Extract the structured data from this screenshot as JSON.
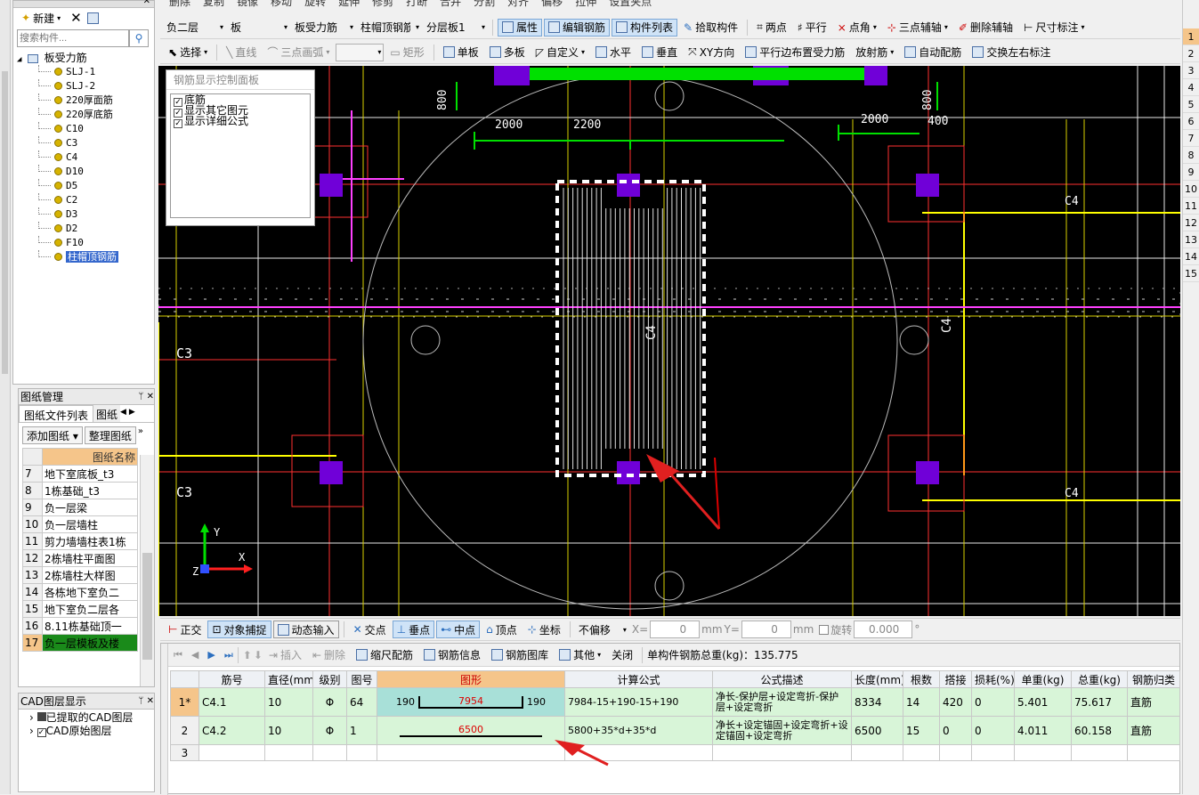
{
  "top_toolbar": [
    "删除",
    "复制",
    "镜像",
    "移动",
    "旋转",
    "延伸",
    "修剪",
    "打断",
    "合并",
    "分割",
    "对齐",
    "偏移",
    "拉伸",
    "设置夹点"
  ],
  "component_panel": {
    "new_label": "新建",
    "search_placeholder": "搜索构件...",
    "root": "板受力筋",
    "items": [
      "SLJ-1",
      "SLJ-2",
      "220厚面筋",
      "220厚底筋",
      "C10",
      "C3",
      "C4",
      "D10",
      "D5",
      "C2",
      "D3",
      "D2",
      "F10",
      "柱帽顶钢筋"
    ],
    "selected": "柱帽顶钢筋"
  },
  "drawing_panel": {
    "title": "图纸管理",
    "tabs": [
      "图纸文件列表",
      "图纸"
    ],
    "add_label": "添加图纸",
    "organize_label": "整理图纸",
    "header": "图纸名称",
    "rows": [
      {
        "no": "7",
        "name": "地下室底板_t3"
      },
      {
        "no": "8",
        "name": "1栋基础_t3"
      },
      {
        "no": "9",
        "name": "负一层梁"
      },
      {
        "no": "10",
        "name": "负一层墙柱"
      },
      {
        "no": "11",
        "name": "剪力墙墙柱表1栋"
      },
      {
        "no": "12",
        "name": "2栋墙柱平面图"
      },
      {
        "no": "13",
        "name": "2栋墙柱大样图"
      },
      {
        "no": "14",
        "name": "各栋地下室负二"
      },
      {
        "no": "15",
        "name": "地下室负二层各"
      },
      {
        "no": "16",
        "name": "8.11栋基础顶一"
      },
      {
        "no": "17",
        "name": "负一层模板及楼"
      }
    ]
  },
  "cad_panel": {
    "title": "CAD图层显示",
    "items": [
      "已提取的CAD图层",
      "CAD原始图层"
    ]
  },
  "toolbar1": {
    "floor": "负二层",
    "type": "板",
    "subtype": "板受力筋",
    "component": "柱帽顶钢筋",
    "layer": "分层板1",
    "buttons": [
      "属性",
      "编辑钢筋",
      "构件列表",
      "拾取构件",
      "两点",
      "平行",
      "点角",
      "三点辅轴",
      "删除辅轴",
      "尺寸标注"
    ]
  },
  "toolbar2": {
    "buttons": [
      "选择",
      "直线",
      "三点画弧",
      "矩形",
      "单板",
      "多板",
      "自定义",
      "水平",
      "垂直",
      "XY方向",
      "平行边布置受力筋",
      "放射筋",
      "自动配筋",
      "交换左右标注"
    ]
  },
  "rebar_panel": {
    "title": "钢筋显示控制面板",
    "options": [
      "底筋",
      "显示其它图元",
      "显示详细公式"
    ]
  },
  "cad_labels": {
    "c3": "C3",
    "c4": "C4",
    "d800": "800",
    "d2000": "2000",
    "d2200": "2200",
    "d400": "400",
    "axis_y": "Y",
    "axis_x": "X",
    "axis_z": "Z"
  },
  "status_bar": {
    "buttons": [
      "正交",
      "对象捕捉",
      "动态输入",
      "交点",
      "垂点",
      "中点",
      "顶点",
      "坐标"
    ],
    "offset_mode": "不偏移",
    "x_label": "X=",
    "x_val": "0",
    "mm1": "mm",
    "y_label": "Y=",
    "y_val": "0",
    "mm2": "mm",
    "rotate_label": "旋转",
    "rotate_val": "0.000",
    "deg": "°"
  },
  "rebar_toolbar": {
    "buttons": [
      "插入",
      "删除",
      "缩尺配筋",
      "钢筋信息",
      "钢筋图库",
      "其他",
      "关闭"
    ],
    "total": "单构件钢筋总重(kg)：135.775"
  },
  "grid": {
    "headers": [
      "筋号",
      "直径(mm)",
      "级别",
      "图号",
      "图形",
      "计算公式",
      "公式描述",
      "长度(mm)",
      "根数",
      "搭接",
      "损耗(%)",
      "单重(kg)",
      "总重(kg)",
      "钢筋归类"
    ],
    "rows": [
      {
        "idx": "1*",
        "name": "C4.1",
        "dia": "10",
        "grade": "Φ",
        "fig": "64",
        "shape_l": "190",
        "shape_mid": "7954",
        "shape_r": "190",
        "formula": "7984-15+190-15+190",
        "desc": "净长-保护层+设定弯折-保护层+设定弯折",
        "len": "8334",
        "count": "14",
        "lap": "420",
        "loss": "0",
        "unit": "5.401",
        "total": "75.617",
        "cat": "直筋"
      },
      {
        "idx": "2",
        "name": "C4.2",
        "dia": "10",
        "grade": "Φ",
        "fig": "1",
        "shape_l": "",
        "shape_mid": "6500",
        "shape_r": "",
        "formula": "5800+35*d+35*d",
        "desc": "净长+设定锚固+设定弯折+设定锚固+设定弯折",
        "len": "6500",
        "count": "15",
        "lap": "0",
        "loss": "0",
        "unit": "4.011",
        "total": "60.158",
        "cat": "直筋"
      },
      {
        "idx": "3",
        "name": "",
        "dia": "",
        "grade": "",
        "fig": "",
        "shape_l": "",
        "shape_mid": "",
        "shape_r": "",
        "formula": "",
        "desc": "",
        "len": "",
        "count": "",
        "lap": "",
        "loss": "",
        "unit": "",
        "total": "",
        "cat": ""
      }
    ]
  },
  "right_numbers": [
    "1",
    "2",
    "3",
    "4",
    "5",
    "6",
    "7",
    "8",
    "9",
    "10",
    "11",
    "12",
    "13",
    "14",
    "15"
  ]
}
